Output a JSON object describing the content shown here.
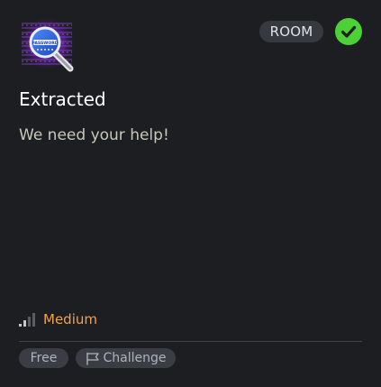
{
  "card": {
    "room_icon": "password-magnifier-icon",
    "badge": "ROOM",
    "completed_icon": "check-circle-icon",
    "title": "Extracted",
    "description": "We need your help!",
    "difficulty": {
      "icon": "signal-bars-icon",
      "label": "Medium",
      "level": 2,
      "max_level": 4
    },
    "tags": [
      {
        "label": "Free",
        "icon": null
      },
      {
        "label": "Challenge",
        "icon": "flag-icon"
      }
    ],
    "icon_text": "PASSWORD",
    "colors": {
      "background": "#1c1e21",
      "difficulty_accent": "#f4a24a",
      "completed_green": "#4cd137",
      "badge_bg": "#363a40",
      "tag_bg": "#3a3e44"
    }
  }
}
